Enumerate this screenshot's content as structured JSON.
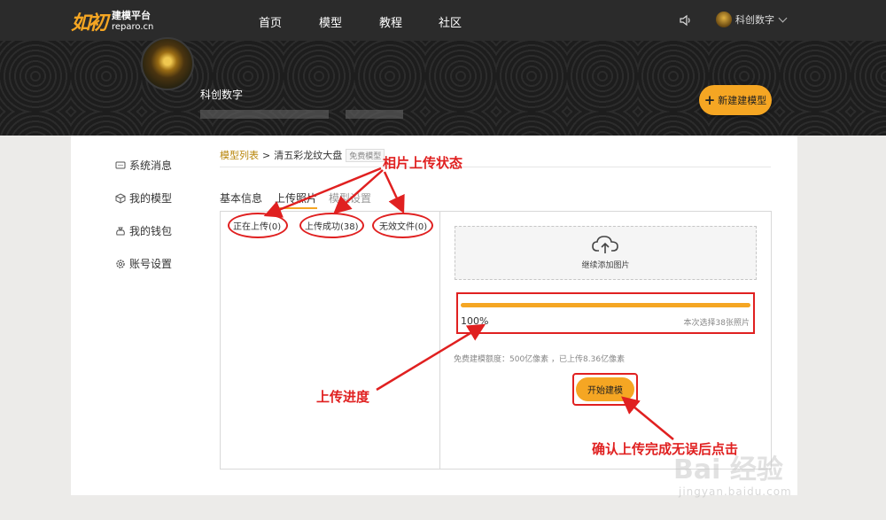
{
  "header": {
    "logo_mark": "如初",
    "logo_line1": "建模平台",
    "logo_line2": "reparo.cn",
    "nav": [
      "首页",
      "模型",
      "教程",
      "社区"
    ],
    "user_name": "科创数字"
  },
  "profile": {
    "name": "科创数字",
    "new_model_label": "新建建模型"
  },
  "sidebar": {
    "items": [
      {
        "label": "系统消息",
        "icon": "message-icon"
      },
      {
        "label": "我的模型",
        "icon": "cube-icon"
      },
      {
        "label": "我的钱包",
        "icon": "wallet-icon"
      },
      {
        "label": "账号设置",
        "icon": "gear-icon"
      }
    ]
  },
  "breadcrumb": {
    "link": "模型列表",
    "sep": ">",
    "current": "清五彩龙纹大盘",
    "tag": "免费模型"
  },
  "tabs": [
    "基本信息",
    "上传照片",
    "模型设置"
  ],
  "status": {
    "uploading": "正在上传(0)",
    "success": "上传成功(38)",
    "invalid": "无效文件(0)"
  },
  "upload": {
    "add_label": "继续添加图片",
    "progress_value": 1.0,
    "progress_text": "100%",
    "selected_text": "本次选择38张照片",
    "quota_text": "免费建模额度：500亿像素 ，已上传8.36亿像素",
    "start_label": "开始建模"
  },
  "annotations": {
    "status_label": "相片上传状态",
    "progress_label": "上传进度",
    "confirm_label": "确认上传完成无误后点击"
  },
  "watermark": {
    "text": "Bai 经验",
    "url": "jingyan.baidu.com"
  },
  "colors": {
    "accent": "#f5a623",
    "annotation": "#e02020",
    "nav_bg": "#2b2b2b"
  }
}
